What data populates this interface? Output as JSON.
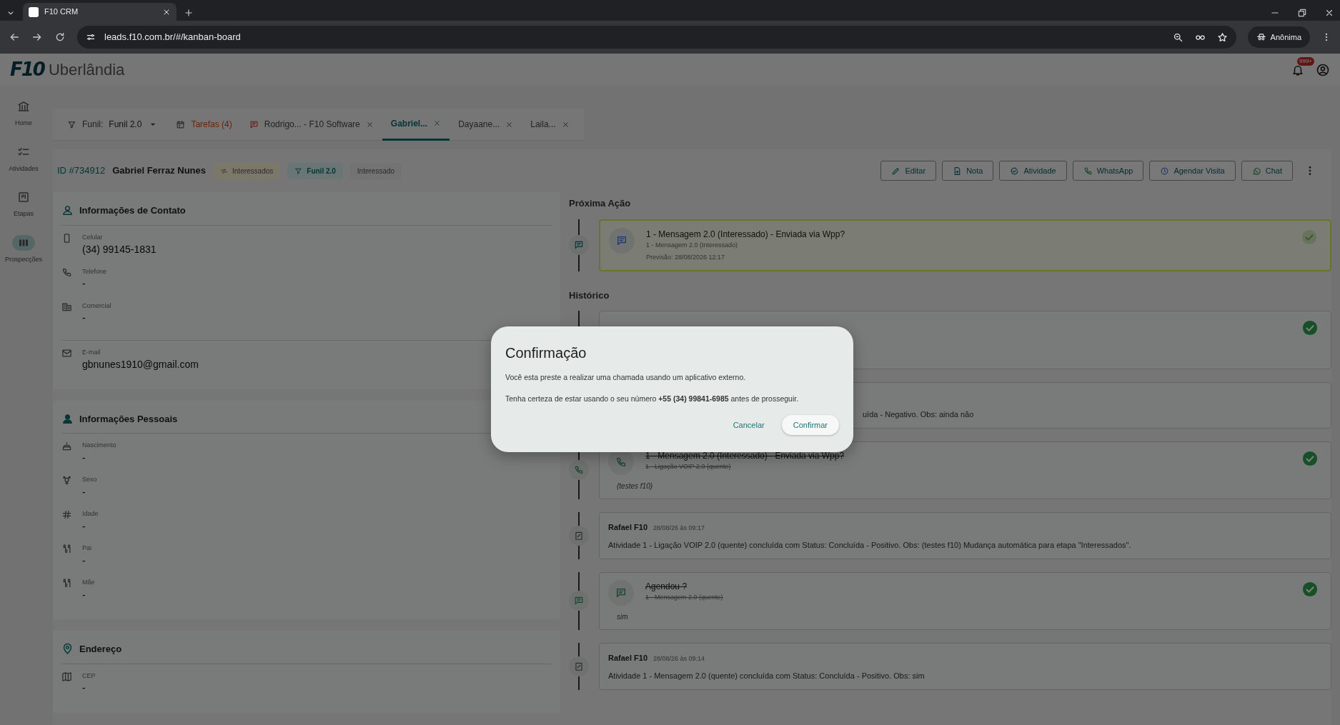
{
  "browser": {
    "tab_title": "F10 CRM",
    "url": "leads.f10.com.br/#/kanban-board",
    "profile": "Anônima"
  },
  "header": {
    "logo": "F10",
    "city": "Uberlândia",
    "notifications": "999+"
  },
  "sidebar": [
    {
      "label": "Home",
      "selected": false
    },
    {
      "label": "Atividades",
      "selected": false
    },
    {
      "label": "Etapas",
      "selected": false
    },
    {
      "label": "Prospecções",
      "selected": true
    }
  ],
  "funnel": {
    "label": "Funil:",
    "value": "Funil 2.0"
  },
  "tabs": [
    {
      "kind": "tasks",
      "label": "Tarefas (4)",
      "closable": false,
      "selected": false
    },
    {
      "kind": "flagged",
      "label": "Rodrigo... - F10 Software",
      "closable": true,
      "selected": false
    },
    {
      "kind": "lead",
      "label": "Gabriel...",
      "closable": true,
      "selected": true
    },
    {
      "kind": "lead",
      "label": "Dayaane...",
      "closable": true,
      "selected": false
    },
    {
      "kind": "lead",
      "label": "Laila...",
      "closable": true,
      "selected": false
    }
  ],
  "lead": {
    "id": "ID #734912",
    "name": "Gabriel Ferraz Nunes",
    "chips": [
      {
        "kind": "stage",
        "label": "Interessados"
      },
      {
        "kind": "funnel",
        "label": "Funil 2.0"
      },
      {
        "kind": "status",
        "label": "Interessado"
      }
    ]
  },
  "actions": [
    "Editar",
    "Nota",
    "Atividade",
    "WhatsApp",
    "Agendar Visita",
    "Chat"
  ],
  "sections": [
    {
      "title": "Informações de Contato",
      "groups": [
        [
          {
            "label": "Celular",
            "value": "(34) 99145-1831"
          },
          {
            "label": "Telefone",
            "value": "-"
          },
          {
            "label": "Comercial",
            "value": "-"
          }
        ],
        [
          {
            "label": "E-mail",
            "value": "gbnunes1910@gmail.com"
          }
        ]
      ]
    },
    {
      "title": "Informações Pessoais",
      "groups": [
        [
          {
            "label": "Nascimento",
            "value": "-"
          },
          {
            "label": "Sexo",
            "value": "-"
          },
          {
            "label": "Idade",
            "value": "-"
          },
          {
            "label": "Pai",
            "value": "-"
          },
          {
            "label": "Mãe",
            "value": "-"
          }
        ]
      ]
    },
    {
      "title": "Endereço",
      "groups": [
        [
          {
            "label": "CEP",
            "value": "-"
          }
        ]
      ]
    }
  ],
  "next_action": {
    "title": "Próxima Ação",
    "item": {
      "kind": "message",
      "title": "1 - Mensagem 2.0 (Interessado) - Enviada via Wpp?",
      "subtitle": "1 - Mensagem 2.0 (Interessado)",
      "meta": "Previsão: 28/08/2026 12:17",
      "done": false
    }
  },
  "history": {
    "title": "Histórico",
    "items": [
      {
        "kind": "message",
        "covered": true,
        "done": true
      },
      {
        "kind": "log",
        "covered": true,
        "text": "uída - Negativo. Obs: ainda não"
      },
      {
        "kind": "call",
        "covered": false,
        "title": "1 - Mensagem 2.0 (Interessado) - Enviada via Wpp?",
        "subtitle": "1 - Ligação VOIP 2.0 (quente)",
        "note": "(testes f10)",
        "done": true
      },
      {
        "kind": "log",
        "covered": false,
        "author": "Rafael F10",
        "date": "28/08/26 às 09:17",
        "text": "Atividade 1 - Ligação VOIP 2.0 (quente) concluída com Status: Concluída - Positivo. Obs: (testes f10) Mudança automática para etapa \"Interessados\"."
      },
      {
        "kind": "message",
        "covered": false,
        "title": "Agendou ?",
        "subtitle": "1 - Mensagem 2.0 (quente)",
        "note": "sim",
        "done": true
      },
      {
        "kind": "log",
        "covered": false,
        "author": "Rafael F10",
        "date": "28/08/26 às 09:14",
        "text": "Atividade 1 - Mensagem 2.0 (quente) concluída com Status: Concluída - Positivo. Obs: sim"
      }
    ]
  },
  "dialog": {
    "title": "Confirmação",
    "paragraphs": [
      "Você esta preste a realizar uma chamada usando um aplicativo externo.",
      "Tenha certeza de estar usando o seu número **+55 (34) 99841-6985** antes de prosseguir."
    ],
    "buttons": [
      {
        "kind": "text",
        "label": "Cancelar"
      },
      {
        "kind": "raised",
        "label": "Confirmar"
      }
    ]
  }
}
